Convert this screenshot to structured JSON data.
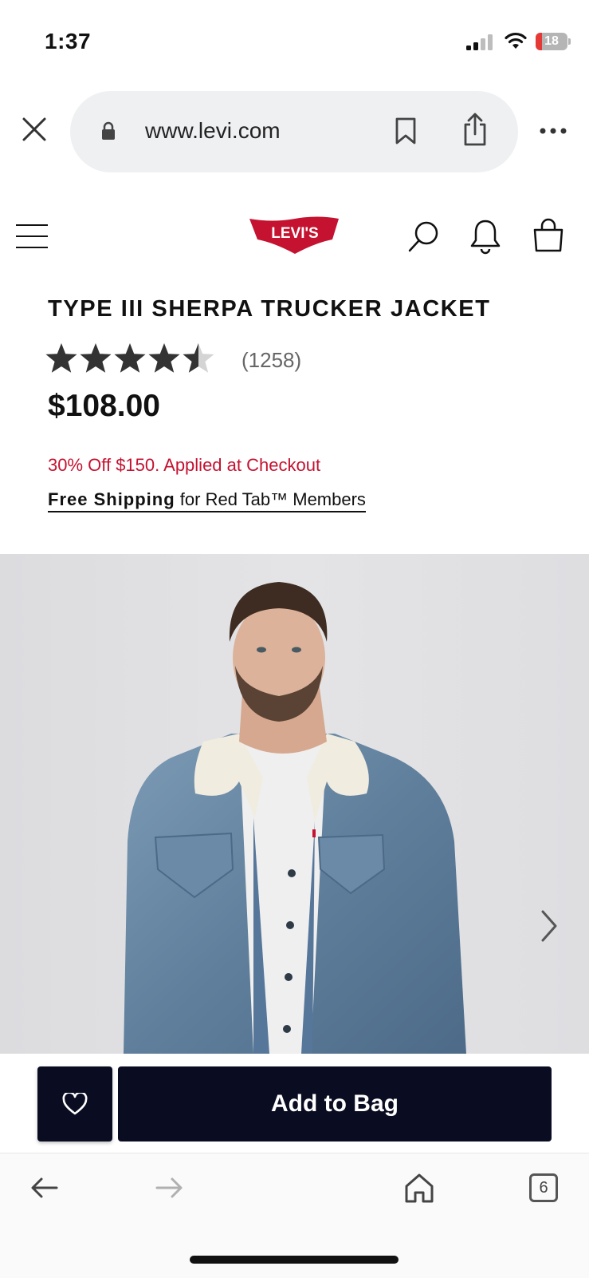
{
  "status_bar": {
    "time": "1:37",
    "battery_level": "18"
  },
  "browser": {
    "url": "www.levi.com",
    "tab_count": "6"
  },
  "site_header": {
    "logo_text": "LEVI'S",
    "logo_registered_mark": "®"
  },
  "product": {
    "title": "TYPE III SHERPA TRUCKER JACKET",
    "rating": 4.5,
    "rating_max": 5,
    "review_count": "(1258)",
    "price": "$108.00",
    "promo": "30% Off $150. Applied at Checkout",
    "shipping_bold": "Free Shipping",
    "shipping_rest": " for Red Tab™ Members"
  },
  "actions": {
    "add_to_bag_label": "Add to Bag"
  },
  "colors": {
    "brand_red": "#c41230",
    "button_navy": "#0a0d22",
    "promo_red": "#c41230"
  }
}
